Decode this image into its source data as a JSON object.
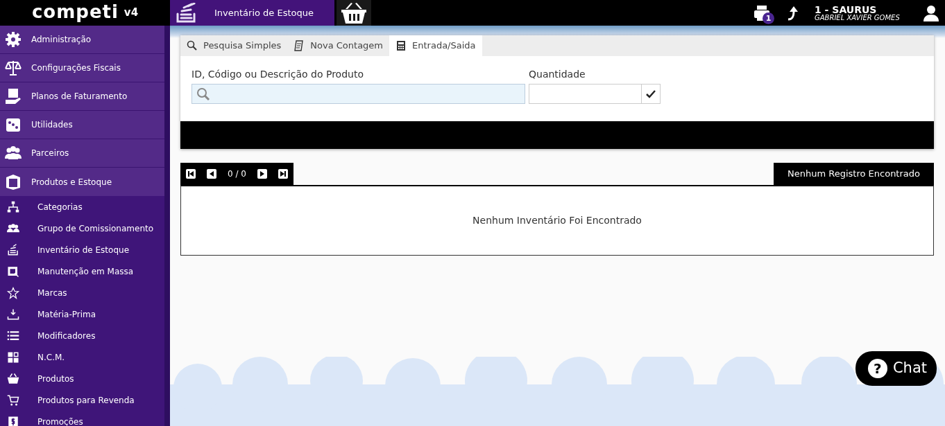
{
  "header": {
    "logo": "competi",
    "logo_version": "v4",
    "title": "Inventário de Estoque",
    "print_badge": "1",
    "company": "1 - SAURUS",
    "user": "GABRIEL XAVIER GOMES"
  },
  "sidebar": {
    "items": [
      {
        "label": "Administração",
        "expanded": false
      },
      {
        "label": "Configurações Fiscais",
        "expanded": false
      },
      {
        "label": "Planos de Faturamento",
        "expanded": false
      },
      {
        "label": "Utilidades",
        "expanded": false
      },
      {
        "label": "Parceiros",
        "expanded": false
      },
      {
        "label": "Produtos e Estoque",
        "expanded": true,
        "children": [
          {
            "label": "Categorias"
          },
          {
            "label": "Grupo de Comissionamento"
          },
          {
            "label": "Inventário de Estoque"
          },
          {
            "label": "Manutenção em Massa"
          },
          {
            "label": "Marcas"
          },
          {
            "label": "Matéria-Prima"
          },
          {
            "label": "Modificadores"
          },
          {
            "label": "N.C.M."
          },
          {
            "label": "Produtos"
          },
          {
            "label": "Produtos para Revenda"
          },
          {
            "label": "Promoções"
          }
        ]
      }
    ]
  },
  "tabs": [
    {
      "label": "Pesquisa Simples",
      "selected": false
    },
    {
      "label": "Nova Contagem",
      "selected": false
    },
    {
      "label": "Entrada/Saida",
      "selected": true
    }
  ],
  "form": {
    "product_label": "ID, Código ou Descrição do Produto",
    "quantity_label": "Quantidade"
  },
  "pager": {
    "position": "0 / 0",
    "status": "Nenhum Registro Encontrado"
  },
  "empty_message": "Nenhum Inventário Foi Encontrado",
  "chat": {
    "icon_text": "?",
    "label": "Chat"
  }
}
